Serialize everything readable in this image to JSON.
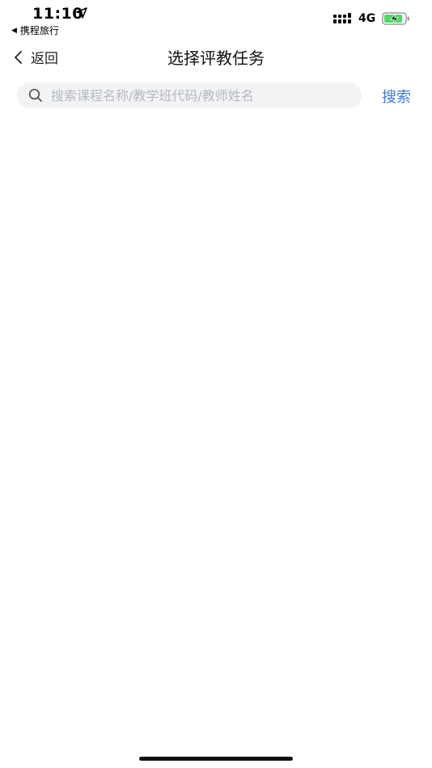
{
  "status_bar": {
    "time": "11:10",
    "back_app": "携程旅行",
    "network": "4G"
  },
  "nav": {
    "back_label": "返回",
    "title": "选择评教任务"
  },
  "search": {
    "placeholder": "搜索课程名称/教学班代码/教师姓名",
    "value": "",
    "button_label": "搜索"
  },
  "colors": {
    "accent": "#3a7bd5",
    "search_bg": "#f2f3f5",
    "battery_fill": "#4cd964"
  },
  "icons": {
    "location": "location-arrow-icon",
    "signal": "signal-icon",
    "battery": "battery-charging-icon",
    "back": "chevron-left-icon",
    "search": "search-icon"
  }
}
